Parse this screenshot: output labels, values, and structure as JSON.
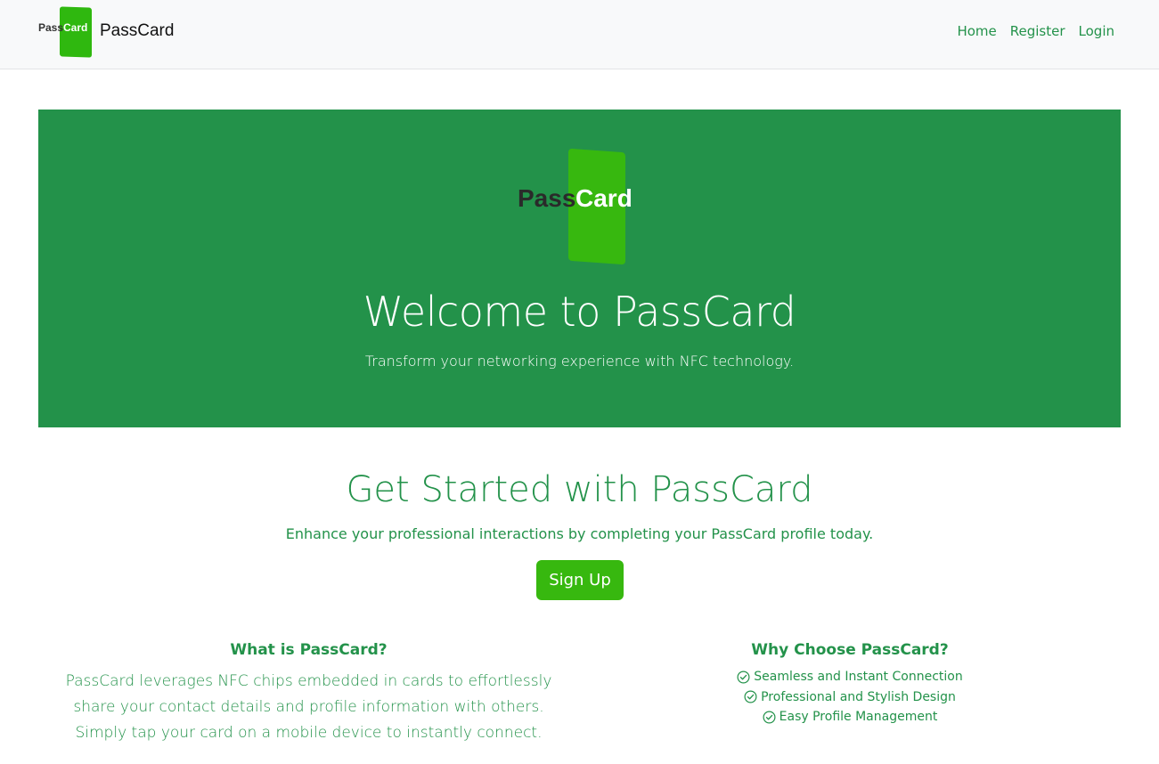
{
  "navbar": {
    "logo_text_pass": "Pass",
    "logo_text_card": "Card",
    "brand_name": "PassCard",
    "links": [
      {
        "label": "Home"
      },
      {
        "label": "Register"
      },
      {
        "label": "Login"
      }
    ]
  },
  "hero": {
    "logo_text_pass": "Pass",
    "logo_text_card": "Card",
    "title": "Welcome to PassCard",
    "subtitle": "Transform your networking experience with NFC technology."
  },
  "get_started": {
    "title": "Get Started with PassCard",
    "subtitle": "Enhance your professional interactions by completing your PassCard profile today.",
    "button_label": "Sign Up"
  },
  "what_is": {
    "title": "What is PassCard?",
    "body": "PassCard leverages NFC chips embedded in cards to effortlessly share your contact details and profile information with others. Simply tap your card on a mobile device to instantly connect."
  },
  "why_choose": {
    "title": "Why Choose PassCard?",
    "items": [
      {
        "label": "Seamless and Instant Connection",
        "icon": "check-circle-icon"
      },
      {
        "label": "Professional and Stylish Design",
        "icon": "check-circle-icon"
      },
      {
        "label": "Easy Profile Management",
        "icon": "check-circle-icon"
      }
    ]
  },
  "colors": {
    "primary_green": "#23924a",
    "accent_green": "#37b80f",
    "navbar_bg": "#f8f9fa"
  }
}
